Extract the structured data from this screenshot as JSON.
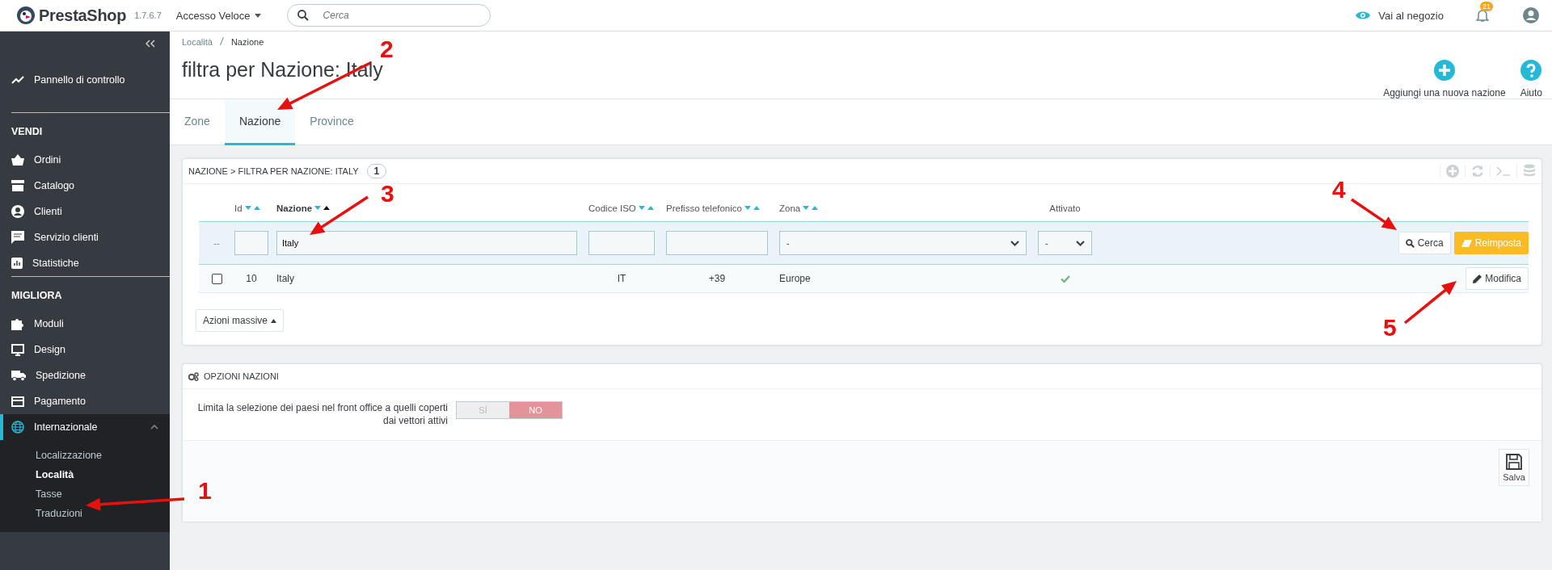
{
  "topbar": {
    "logo": "PrestaShop",
    "version": "1.7.6.7",
    "quick_access": "Accesso Veloce",
    "search": {
      "placeholder": "Cerca"
    },
    "shop_link": "Vai al negozio",
    "notifications": "21"
  },
  "sidebar": {
    "dashboard": {
      "label": "Pannello di controllo",
      "selected": false
    },
    "sections": [
      {
        "title": "VENDI",
        "items": [
          {
            "label": "Ordini",
            "selected": false
          },
          {
            "label": "Catalogo",
            "selected": false
          },
          {
            "label": "Clienti",
            "selected": false
          },
          {
            "label": "Servizio clienti",
            "selected": false
          },
          {
            "label": "Statistiche",
            "selected": false
          }
        ]
      },
      {
        "title": "MIGLIORA",
        "items": [
          {
            "label": "Moduli",
            "selected": false
          },
          {
            "label": "Design",
            "selected": false
          },
          {
            "label": "Spedizione",
            "selected": false
          },
          {
            "label": "Pagamento",
            "selected": false
          },
          {
            "label": "Internazionale",
            "selected": true,
            "expanded": true,
            "children": [
              {
                "label": "Localizzazione",
                "selected": false
              },
              {
                "label": "Località",
                "selected": true
              },
              {
                "label": "Tasse",
                "selected": false
              },
              {
                "label": "Traduzioni",
                "selected": false
              }
            ]
          }
        ]
      }
    ]
  },
  "header": {
    "breadcrumb": [
      "Località",
      "Nazione"
    ],
    "title": "filtra per Nazione: Italy",
    "toolbar": [
      {
        "label": "Aggiungi una nuova nazione"
      },
      {
        "label": "Aiuto"
      }
    ],
    "tabs": [
      {
        "label": "Zone",
        "selected": false
      },
      {
        "label": "Nazione",
        "selected": true
      },
      {
        "label": "Province",
        "selected": false
      }
    ]
  },
  "list_panel": {
    "title": "NAZIONE > FILTRA PER NAZIONE: ITALY",
    "count": "1",
    "columns": [
      {
        "label": "Id",
        "sortable": true,
        "sorted_asc": false
      },
      {
        "label": "Nazione",
        "sortable": true,
        "sorted_asc": true
      },
      {
        "label": "Codice ISO",
        "sortable": true,
        "sorted_asc": false
      },
      {
        "label": "Prefisso telefonico",
        "sortable": true,
        "sorted_asc": false
      },
      {
        "label": "Zona",
        "sortable": true,
        "sorted_asc": false
      },
      {
        "label": "Attivato",
        "sortable": false,
        "sorted_asc": false
      }
    ],
    "filters": {
      "bulk": "--",
      "name": "Italy",
      "zone": "-",
      "active": "-"
    },
    "search_button": "Cerca",
    "reset_button": "Reimposta",
    "rows": [
      {
        "checked": false,
        "id": "10",
        "name": "Italy",
        "iso": "IT",
        "prefix": "+39",
        "zone": "Europe",
        "active": true,
        "action": "Modifica"
      }
    ],
    "bulk_button": "Azioni massive"
  },
  "options_panel": {
    "title": "OPZIONI NAZIONI",
    "field_label": "Limita la selezione dei paesi nel front office a quelli coperti dai vettori attivi",
    "toggle": [
      {
        "label": "SÌ",
        "selected": false
      },
      {
        "label": "NO",
        "selected": true
      }
    ],
    "save_button": "Salva"
  },
  "annotations": [
    {
      "label": "1"
    },
    {
      "label": "2"
    },
    {
      "label": "3"
    },
    {
      "label": "4"
    },
    {
      "label": "5"
    }
  ]
}
